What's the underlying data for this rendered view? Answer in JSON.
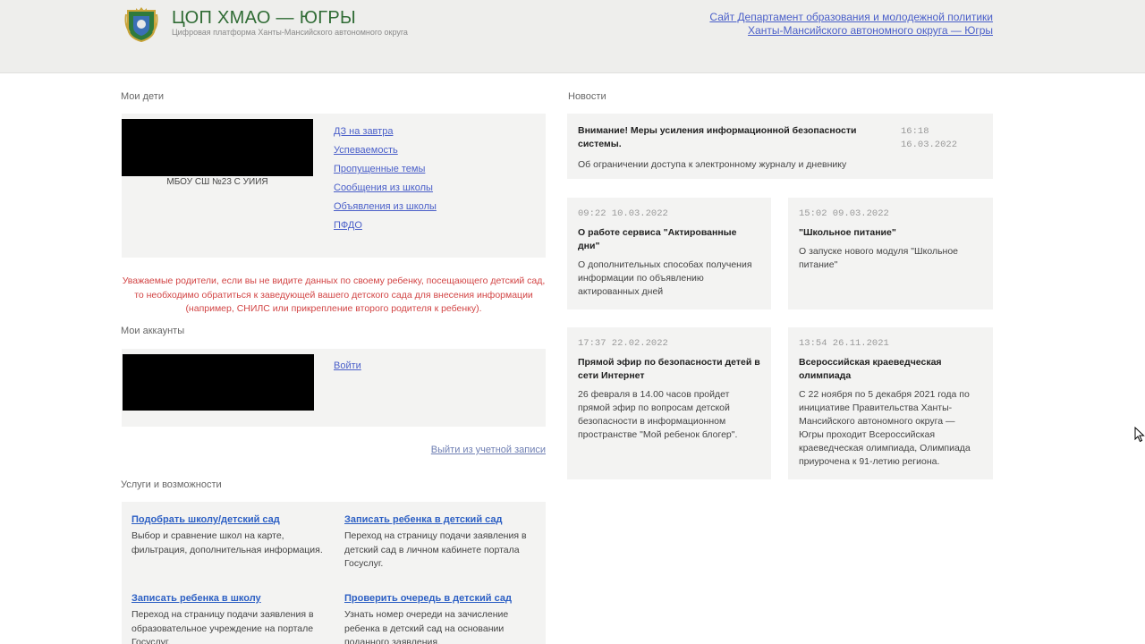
{
  "header": {
    "title": "ЦОП ХМАО — ЮГРЫ",
    "subtitle": "Цифровая платформа Ханты-Мансийского автономного округа",
    "dept_link_line1": "Сайт Департамент образования и молодежной политики",
    "dept_link_line2": "Ханты-Мансийского автономного округа — Югры"
  },
  "children": {
    "section_title": "Мои дети",
    "school": "МБОУ СШ №23 С УИИЯ",
    "links": [
      "ДЗ на завтра",
      "Успеваемость",
      "Пропущенные темы",
      "Сообщения из школы",
      "Объявления из школы",
      "ПФДО"
    ],
    "warning": "Уважаемые родители, если вы не видите данных по своему ребенку, посещающего детский сад, то необходимо обратиться к заведующей вашего детского сада для внесения информации (например, СНИЛС или прикрепление второго родителя к ребенку)."
  },
  "accounts": {
    "section_title": "Мои аккаунты",
    "login": "Войти",
    "logout": "Выйти из учетной записи"
  },
  "services": {
    "section_title": "Услуги и возможности",
    "items": [
      {
        "title": "Подобрать школу/детский сад",
        "desc": "Выбор и сравнение школ на карте, фильтрация, дополнительная информация."
      },
      {
        "title": "Записать ребенка в детский сад",
        "desc": "Переход на страницу подачи заявления в детский сад в личном кабинете портала Госуслуг."
      },
      {
        "title": "Записать ребенка в школу",
        "desc": "Переход на страницу подачи заявления в образовательное учреждение на портале Госуслуг."
      },
      {
        "title": "Проверить очередь в детский сад",
        "desc": "Узнать номер очереди на зачисление ребенка в детский сад на основании поданного заявления."
      }
    ]
  },
  "news": {
    "section_title": "Новости",
    "main": {
      "title": "Внимание! Меры усиления информационной безопасности системы.",
      "time": "16:18",
      "date": "16.03.2022",
      "desc": "Об ограничении доступа к электронному журналу и дневнику"
    },
    "items": [
      {
        "date": "09:22 10.03.2022",
        "title": "О работе сервиса \"Актированные дни\"",
        "desc": "О дополнительных способах получения информации по объявлению актированных дней"
      },
      {
        "date": "15:02 09.03.2022",
        "title": "\"Школьное питание\"",
        "desc": "О запуске нового модуля \"Школьное питание\""
      },
      {
        "date": "17:37 22.02.2022",
        "title": "Прямой эфир по безопасности детей в сети Интернет",
        "desc": "26 февраля в 14.00 часов пройдет прямой эфир по вопросам детской безопасности в информационном пространстве \"Мой ребенок блогер\"."
      },
      {
        "date": "13:54 26.11.2021",
        "title": "Всероссийская краеведческая олимпиада",
        "desc": "С 22 ноября по 5 декабря 2021 года по инициативе Правительства Ханты-Мансийского автономного округа — Югры проходит Всероссийская краеведческая олимпиада, Олимпиада приурочена к 91-летию региона."
      }
    ]
  },
  "colors": {
    "header_bg": "#eeeeec",
    "title_green": "#2f6b34",
    "link_blue": "#4a5fc9",
    "warning_red": "#d24545",
    "card_bg": "#f3f3f2"
  }
}
